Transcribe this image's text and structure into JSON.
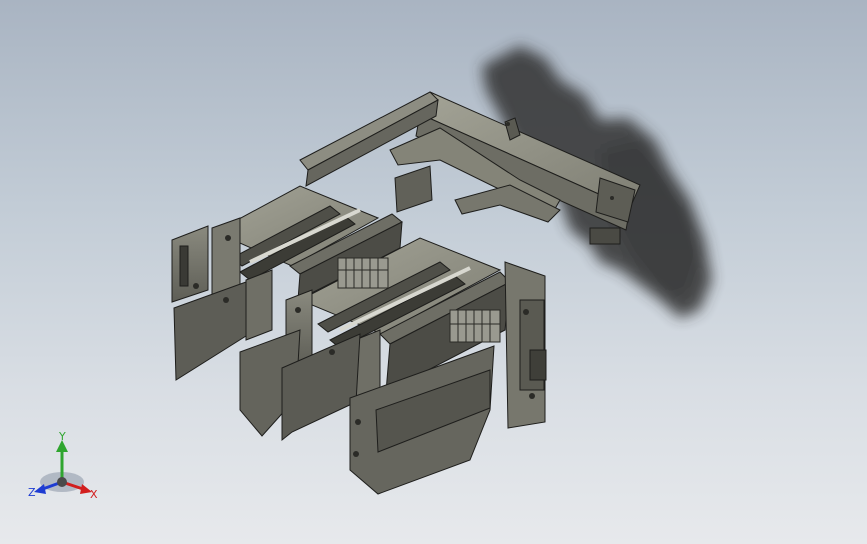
{
  "viewport": {
    "background_top": "#a9b4c2",
    "background_bottom": "#e7e9ec",
    "model_color": "#7a7a70",
    "edge_color": "#1e1e1c",
    "shadow_color": "#2e2e2e"
  },
  "triad": {
    "x_label": "X",
    "y_label": "Y",
    "z_label": "Z",
    "x_color": "#d21e1e",
    "y_color": "#2fa52f",
    "z_color": "#1e3cd2"
  }
}
